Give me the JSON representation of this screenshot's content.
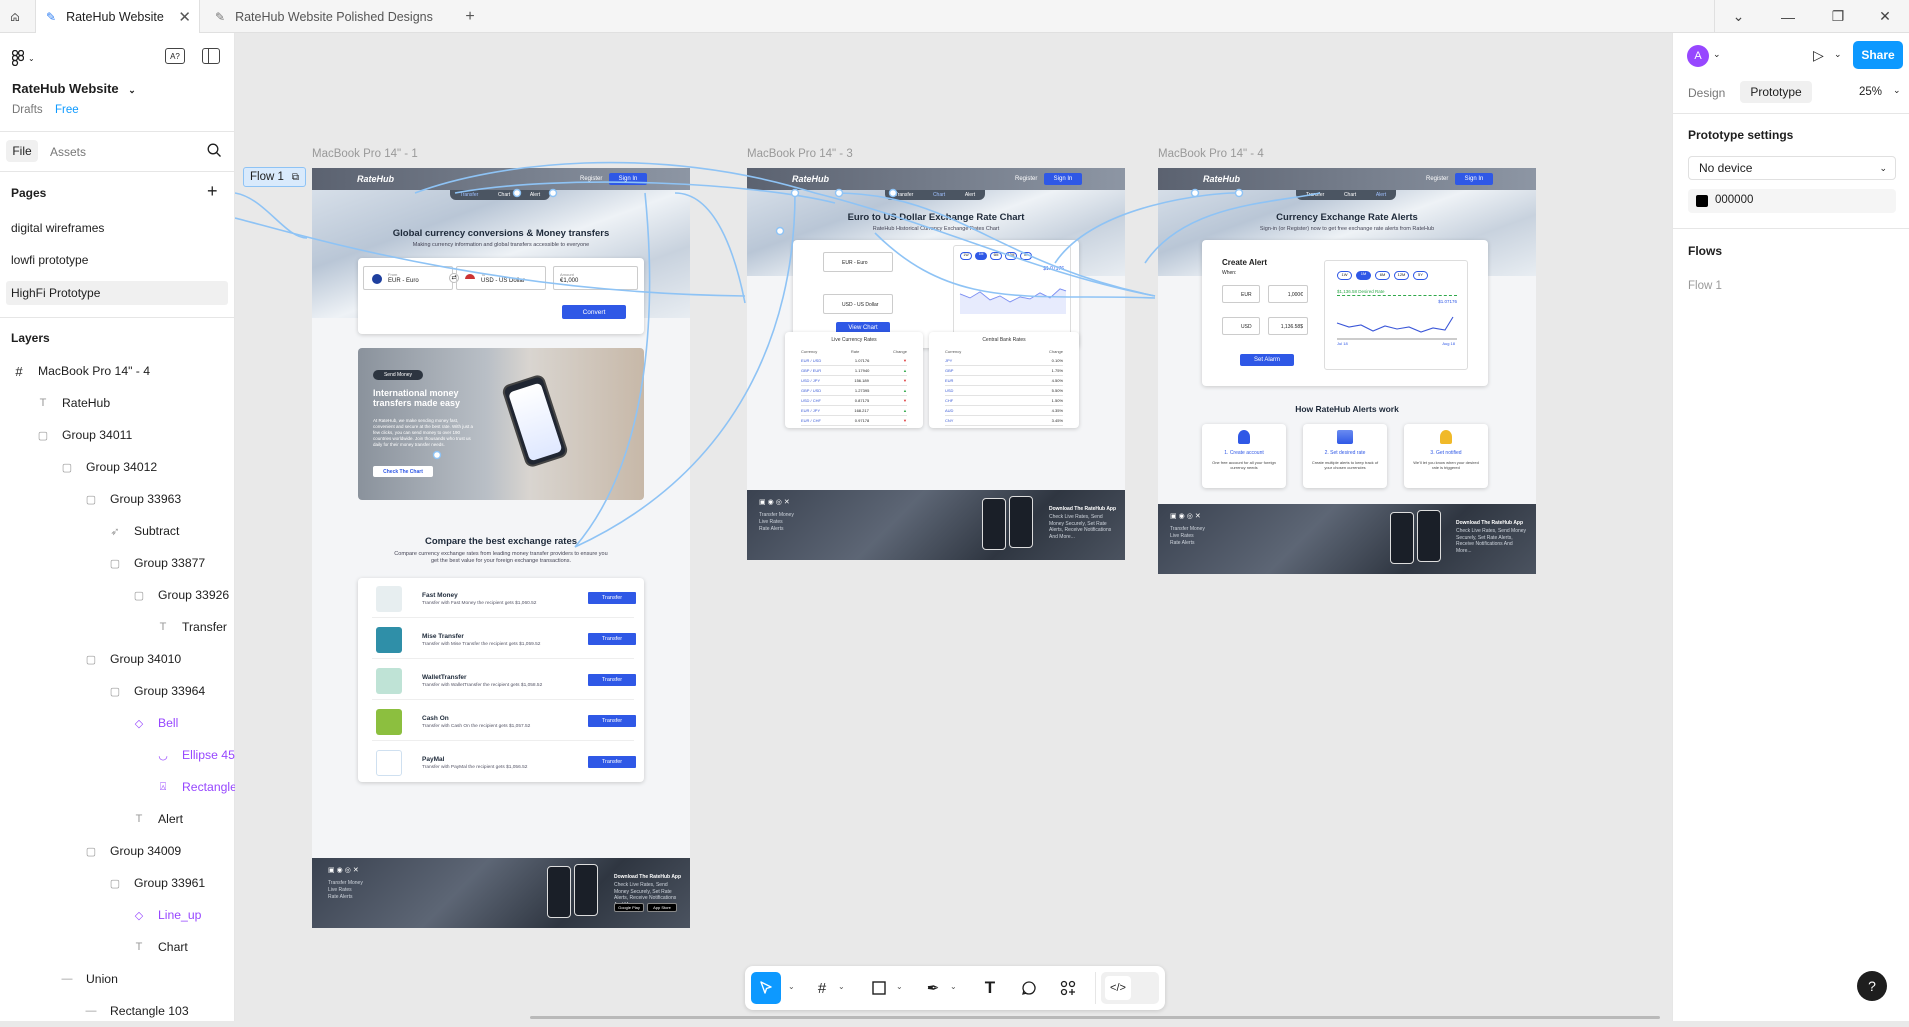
{
  "tabs": [
    {
      "label": "RateHub Website",
      "active": true
    },
    {
      "label": "RateHub Website Polished Designs",
      "active": false
    }
  ],
  "file": {
    "name": "RateHub Website",
    "location": "Drafts",
    "plan": "Free"
  },
  "left_tabs": {
    "file": "File",
    "assets": "Assets"
  },
  "pages": {
    "heading": "Pages",
    "items": [
      "digital wireframes",
      "lowfi prototype",
      "HighFi Prototype"
    ],
    "selected": "HighFi Prototype"
  },
  "layers": {
    "heading": "Layers",
    "items": [
      {
        "label": "MacBook Pro 14\" - 4",
        "indent": 0,
        "type": "frame"
      },
      {
        "label": "RateHub",
        "indent": 1,
        "type": "text"
      },
      {
        "label": "Group 34011",
        "indent": 1,
        "type": "group"
      },
      {
        "label": "Group 34012",
        "indent": 2,
        "type": "group"
      },
      {
        "label": "Group 33963",
        "indent": 3,
        "type": "group"
      },
      {
        "label": "Subtract",
        "indent": 4,
        "type": "vector"
      },
      {
        "label": "Group 33877",
        "indent": 4,
        "type": "group"
      },
      {
        "label": "Group 33926",
        "indent": 5,
        "type": "group"
      },
      {
        "label": "Transfer",
        "indent": 6,
        "type": "text"
      },
      {
        "label": "Group 34010",
        "indent": 3,
        "type": "group"
      },
      {
        "label": "Group 33964",
        "indent": 4,
        "type": "group"
      },
      {
        "label": "Bell",
        "indent": 5,
        "type": "component"
      },
      {
        "label": "Ellipse 45",
        "indent": 6,
        "type": "ellipse"
      },
      {
        "label": "Rectangle",
        "indent": 6,
        "type": "bell"
      },
      {
        "label": "Alert",
        "indent": 5,
        "type": "text"
      },
      {
        "label": "Group 34009",
        "indent": 3,
        "type": "group"
      },
      {
        "label": "Group 33961",
        "indent": 4,
        "type": "group"
      },
      {
        "label": "Line_up",
        "indent": 5,
        "type": "component"
      },
      {
        "label": "Chart",
        "indent": 5,
        "type": "text"
      },
      {
        "label": "Union",
        "indent": 2,
        "type": "union"
      },
      {
        "label": "Rectangle 103",
        "indent": 3,
        "type": "rect"
      }
    ]
  },
  "right": {
    "avatar": "A",
    "share": "Share",
    "tab_design": "Design",
    "tab_prototype": "Prototype",
    "zoom": "25%",
    "settings_heading": "Prototype settings",
    "device": "No device",
    "bg_color": "000000",
    "flows_heading": "Flows",
    "flow_item": "Flow 1"
  },
  "canvas": {
    "flow_label": "Flow 1",
    "frames": [
      {
        "label": "MacBook Pro 14\" - 1"
      },
      {
        "label": "MacBook Pro 14\" - 3"
      },
      {
        "label": "MacBook Pro 14\" - 4"
      }
    ]
  },
  "frame1": {
    "logo": "RateHub",
    "register": "Register",
    "signin": "Sign In",
    "nav": [
      "Transfer",
      "Chart",
      "Alert"
    ],
    "title": "Global currency conversions & Money transfers",
    "subtitle": "Making currency information and global transfers accessible to everyone",
    "from_label": "From",
    "from_value": "EUR - Euro",
    "to_label": "To",
    "to_value": "USD - US Dollar",
    "amount_label": "Amount",
    "amount_value": "€1,000",
    "convert": "Convert",
    "promo_badge": "Send Money",
    "promo_title": "International money transfers made easy",
    "promo_text": "At RateHub, we make sending money fast, convenient and secure at the best rate. With just a few clicks, you can send money to over 190 countries worldwide. Join thousands who trust us daily for their money transfer needs.",
    "promo_btn": "Check The Chart",
    "compare_title": "Compare the best exchange rates",
    "compare_sub": "Compare currency exchange rates from leading money transfer providers to ensure you get the best value for your foreign exchange transactions.",
    "providers": [
      {
        "name": "Fast Money",
        "desc": "Transfer with Fast Money the recipient gets $1,060.52",
        "color": "#e7eef0"
      },
      {
        "name": "Mise Transfer",
        "desc": "Transfer with Mise Transfer the recipient gets $1,059.52",
        "color": "#2f8fa8"
      },
      {
        "name": "WalletTransfer",
        "desc": "Transfer with WalletTransfer the recipient gets $1,058.52",
        "color": "#bfe3d6"
      },
      {
        "name": "Cash On",
        "desc": "Transfer with Cash On the recipient gets $1,057.52",
        "color": "#8cbf3f"
      },
      {
        "name": "PayMal",
        "desc": "Transfer with PayMal the recipient gets $1,056.52",
        "color": "#ffffff"
      }
    ],
    "transfer_btn": "Transfer",
    "footer_links": [
      "Transfer Money",
      "Live Rates",
      "Rate Alerts"
    ],
    "footer_app_title": "Download The RateHub App",
    "footer_app_text": "Check Live Rates, Send Money Securely, Set Rate Alerts, Receive Notifications And More...",
    "google_play": "Google Play",
    "app_store": "App Store"
  },
  "frame3": {
    "logo": "RateHub",
    "register": "Register",
    "signin": "Sign In",
    "nav": [
      "Transfer",
      "Chart",
      "Alert"
    ],
    "title": "Euro to US Dollar Exchange Rate Chart",
    "subtitle": "RateHub Historical Currency Exchange Rates Chart",
    "from_value": "EUR - Euro",
    "to_value": "USD - US Dollar",
    "view_chart": "View Chart",
    "ranges": [
      "1W",
      "1M",
      "6M",
      "12M",
      "5Y"
    ],
    "chart_value": "$1.07176",
    "live_title": "Live Currency Rates",
    "central_title": "Central Bank Rates",
    "live_headers": [
      "Currency",
      "Rate",
      "Change"
    ],
    "live_rows": [
      {
        "pair": "EUR / USD",
        "rate": "1.07176"
      },
      {
        "pair": "GBP / EUR",
        "rate": "1.17940"
      },
      {
        "pair": "USD / JPY",
        "rate": "156.189"
      },
      {
        "pair": "GBP / USD",
        "rate": "1.27395"
      },
      {
        "pair": "USD / CHF",
        "rate": "0.87175"
      },
      {
        "pair": "EUR / JPY",
        "rate": "168.217"
      },
      {
        "pair": "EUR / CHF",
        "rate": "0.97178"
      }
    ],
    "central_headers": [
      "Currency",
      "Change"
    ],
    "central_rows": [
      {
        "cur": "JPY",
        "chg": "0.10%"
      },
      {
        "cur": "GBP",
        "chg": "1.75%"
      },
      {
        "cur": "EUR",
        "chg": "4.50%"
      },
      {
        "cur": "USD",
        "chg": "5.50%"
      },
      {
        "cur": "CHF",
        "chg": "1.50%"
      },
      {
        "cur": "AUD",
        "chg": "4.35%"
      },
      {
        "cur": "CNY",
        "chg": "3.45%"
      }
    ],
    "footer_links": [
      "Transfer Money",
      "Live Rates",
      "Rate Alerts"
    ],
    "footer_app_title": "Download The RateHub App",
    "footer_app_text": "Check Live Rates, Send Money Securely, Set Rate Alerts, Receive Notifications And More..."
  },
  "frame4": {
    "logo": "RateHub",
    "register": "Register",
    "signin": "Sign In",
    "nav": [
      "Transfer",
      "Chart",
      "Alert"
    ],
    "title": "Currency Exchange Rate Alerts",
    "subtitle": "Sign-in (or Register) now to get free exchange rate alerts from RateHub",
    "create_alert": "Create Alert",
    "when": "When:",
    "eur": "EUR",
    "usd": "USD",
    "amount1": "1,000€",
    "amount2": "1,136.58$",
    "set_alarm": "Set Alarm",
    "ranges": [
      "1W",
      "1M",
      "6M",
      "12M",
      "5Y"
    ],
    "desired_rate": "$1,136.58 Desired Rate",
    "chart_value": "$1.07176",
    "date_start": "Jul 18",
    "date_end": "Aug 18",
    "how_title": "How RateHub Alerts work",
    "steps": [
      {
        "title": "1. Create account",
        "text": "One free account for all your foreign currency needs"
      },
      {
        "title": "2. Set desired rate",
        "text": "Create multiple alerts to keep track of your chosen currencies"
      },
      {
        "title": "3. Get notified",
        "text": "We'll let you know when your desired rate is triggered"
      }
    ],
    "footer_links": [
      "Transfer Money",
      "Live Rates",
      "Rate Alerts"
    ],
    "footer_app_title": "Download The RateHub App",
    "footer_app_text": "Check Live Rates, Send Money Securely, Set Rate Alerts, Receive Notifications And More..."
  },
  "help": "?"
}
